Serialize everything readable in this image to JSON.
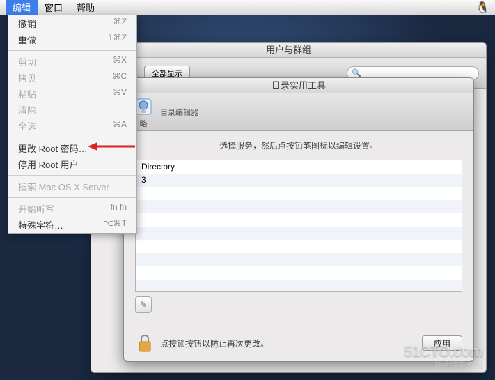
{
  "menubar": {
    "items": [
      "编辑",
      "窗口",
      "帮助"
    ],
    "active_index": 0
  },
  "dropdown": {
    "groups": [
      [
        {
          "label": "撤销",
          "shortcut": "⌘Z",
          "disabled": false
        },
        {
          "label": "重做",
          "shortcut": "⇧⌘Z",
          "disabled": false
        }
      ],
      [
        {
          "label": "剪切",
          "shortcut": "⌘X",
          "disabled": true
        },
        {
          "label": "拷贝",
          "shortcut": "⌘C",
          "disabled": true
        },
        {
          "label": "粘贴",
          "shortcut": "⌘V",
          "disabled": true
        },
        {
          "label": "清除",
          "shortcut": "",
          "disabled": true
        },
        {
          "label": "全选",
          "shortcut": "⌘A",
          "disabled": true
        }
      ],
      [
        {
          "label": "更改 Root 密码…",
          "shortcut": "",
          "disabled": false
        },
        {
          "label": "停用 Root 用户",
          "shortcut": "",
          "disabled": false
        }
      ],
      [
        {
          "label": "搜索 Mac OS X Server",
          "shortcut": "",
          "disabled": true
        }
      ],
      [
        {
          "label": "开始听写",
          "shortcut": "fn fn",
          "disabled": true
        },
        {
          "label": "特殊字符…",
          "shortcut": "⌥⌘T",
          "disabled": false
        }
      ]
    ]
  },
  "users_window": {
    "title": "用户与群组",
    "show_all": "全部显示",
    "search_placeholder": ""
  },
  "dir_window": {
    "title": "目录实用工具",
    "tool1": "略",
    "tool2": "目录编辑器",
    "instruction": "选择服务，然后点按铅笔图标以编辑设置。",
    "rows": [
      "Directory",
      "3",
      "",
      "",
      "",
      "",
      "",
      "",
      "",
      ""
    ],
    "lock_text": "点按锁按钮以防止再次更改。",
    "apply": "应用"
  },
  "watermark": {
    "main": "51CTO.com",
    "sub": "技术博客   Blog"
  }
}
